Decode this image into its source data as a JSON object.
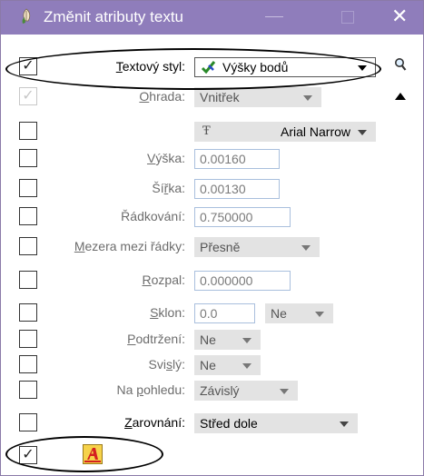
{
  "window": {
    "title": "Změnit atributy textu"
  },
  "rows": {
    "text_style": {
      "label_pre": "",
      "label_u": "T",
      "label_post": "extový styl:",
      "value": "Výšky bodů",
      "checked": true
    },
    "fence": {
      "label_pre": "",
      "label_u": "O",
      "label_post": "hrada:",
      "value": "Vnitřek",
      "checked": true
    },
    "font": {
      "value": "Arial Narrow"
    },
    "height": {
      "label_pre": "",
      "label_u": "V",
      "label_post": "ýška:",
      "value": "0.00160"
    },
    "width": {
      "label_pre": "Ší",
      "label_u": "ř",
      "label_post": "ka:",
      "value": "0.00130"
    },
    "line_spacing": {
      "label_pre": "Řádkování",
      "label_u": "",
      "label_post": ":",
      "value": "0.750000"
    },
    "line_spacing_mode": {
      "label_pre": "",
      "label_u": "M",
      "label_post": "ezera mezi řádky:",
      "value": "Přesně"
    },
    "spacing": {
      "label_pre": "",
      "label_u": "R",
      "label_post": "ozpal:",
      "value": "0.000000"
    },
    "slant": {
      "label_pre": "",
      "label_u": "S",
      "label_post": "klon:",
      "value": "0.0",
      "mode": "Ne"
    },
    "underline": {
      "label_pre": "",
      "label_u": "P",
      "label_post": "odtržení:",
      "value": "Ne"
    },
    "vertical": {
      "label_pre": "Svi",
      "label_u": "s",
      "label_post": "lý:",
      "value": "Ne"
    },
    "view_dependent": {
      "label_pre": "Na ",
      "label_u": "p",
      "label_post": "ohledu:",
      "value": "Závislý"
    },
    "justification": {
      "label_pre": "",
      "label_u": "Z",
      "label_post": "arovnání:",
      "value": "Střed dole"
    },
    "color": {
      "checked": true
    }
  },
  "icons": {
    "title_icon": "feather-pen-icon",
    "style_icon": "check-brush-icon",
    "font_icon": "truetype-icon",
    "search": "magnifier-icon",
    "collapse": "triangle-up-icon",
    "color_icon": "text-color-icon"
  },
  "colors": {
    "titlebar": "#8f7dbb",
    "field_border": "#a9bfdd",
    "disabled_combo": "#e3e3e3"
  }
}
